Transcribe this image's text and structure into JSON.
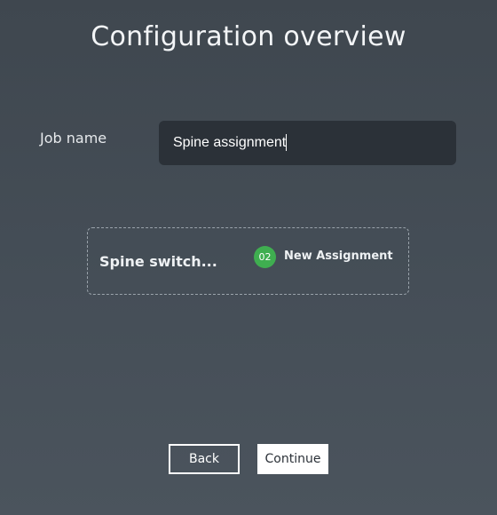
{
  "page": {
    "title": "Configuration overview"
  },
  "job": {
    "label": "Job name",
    "value": "Spine assignment"
  },
  "assignment": {
    "name": "Spine switch...",
    "badge": "02",
    "label": "New Assignment",
    "badge_color": "#3fae50"
  },
  "actions": {
    "back_label": "Back",
    "continue_label": "Continue"
  }
}
